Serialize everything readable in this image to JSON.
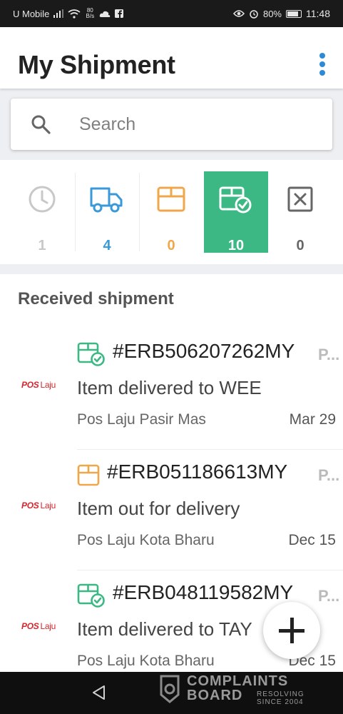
{
  "status_bar": {
    "carrier": "U Mobile",
    "net_speed": "80",
    "net_unit": "B/s",
    "battery": "80%",
    "time": "11:48"
  },
  "header": {
    "title": "My Shipment",
    "menu_icon": "more-vert-icon"
  },
  "search": {
    "placeholder": "Search",
    "value": "",
    "icon": "search-icon"
  },
  "tabs": [
    {
      "icon": "clock-icon",
      "count": "1",
      "color": "#c8c8c8",
      "selected": false
    },
    {
      "icon": "truck-icon",
      "count": "4",
      "color": "#3a9ad9",
      "selected": false
    },
    {
      "icon": "box-icon",
      "count": "0",
      "color": "#f0a74a",
      "selected": false
    },
    {
      "icon": "box-check-icon",
      "count": "10",
      "color": "#ffffff",
      "selected": true
    },
    {
      "icon": "x-box-icon",
      "count": "0",
      "color": "#666666",
      "selected": false
    }
  ],
  "accent_color": "#3bb884",
  "section": {
    "title": "Received shipment"
  },
  "shipments": [
    {
      "logo_main": "POS",
      "logo_sub": "Laju",
      "status_icon": "box-check-icon",
      "tracking": "#ERB506207262MY",
      "truncated": "P...",
      "status": "Item delivered to WEE",
      "location": "Pos Laju Pasir Mas",
      "date": "Mar 29"
    },
    {
      "logo_main": "POS",
      "logo_sub": "Laju",
      "status_icon": "box-icon",
      "tracking": "#ERB051186613MY",
      "truncated": "P...",
      "status": "Item out for delivery",
      "location": "Pos Laju Kota Bharu",
      "date": "Dec 15"
    },
    {
      "logo_main": "POS",
      "logo_sub": "Laju",
      "status_icon": "box-check-icon",
      "tracking": "#ERB048119582MY",
      "truncated": "P...",
      "status": "Item delivered to TAY",
      "location": "Pos Laju Kota Bharu",
      "date": "Dec 15"
    }
  ],
  "fab": {
    "icon": "plus-icon"
  },
  "watermark": {
    "line1": "COMPLAINTS",
    "line2": "BOARD",
    "side1": "RESOLVING",
    "side2": "SINCE 2004"
  }
}
